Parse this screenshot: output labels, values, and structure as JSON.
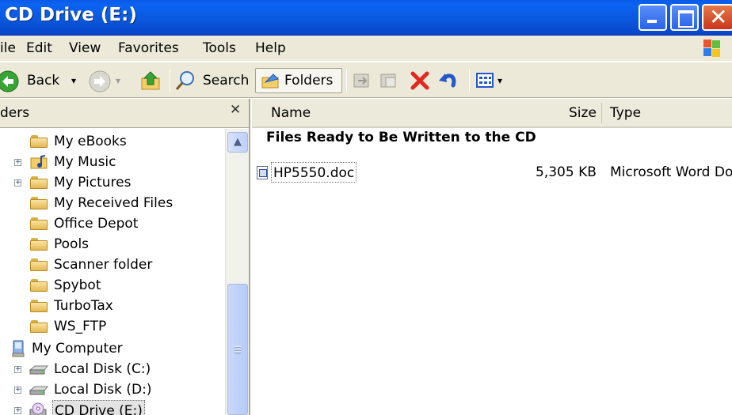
{
  "window": {
    "title": "CD Drive (E:)"
  },
  "menu": [
    "ile",
    "Edit",
    "View",
    "Favorites",
    "Tools",
    "Help"
  ],
  "toolbar": {
    "back_label": "Back",
    "search_label": "Search",
    "folders_label": "Folders"
  },
  "folders_pane": {
    "header": "ders",
    "items": [
      {
        "label": "My eBooks"
      },
      {
        "label": "My Music"
      },
      {
        "label": "My Pictures"
      },
      {
        "label": "My Received Files"
      },
      {
        "label": "Office Depot"
      },
      {
        "label": "Pools"
      },
      {
        "label": "Scanner folder"
      },
      {
        "label": "Spybot"
      },
      {
        "label": "TurboTax"
      },
      {
        "label": "WS_FTP"
      },
      {
        "label": "My Computer"
      },
      {
        "label": "Local Disk (C:)"
      },
      {
        "label": "Local Disk (D:)"
      },
      {
        "label": "CD Drive (E:)"
      }
    ]
  },
  "file_list": {
    "columns": {
      "name": "Name",
      "size": "Size",
      "type": "Type"
    },
    "group_title": "Files Ready to Be Written to the CD",
    "files": [
      {
        "name": "HP5550.doc",
        "size": "5,305 KB",
        "type": "Microsoft Word Do"
      }
    ]
  },
  "colors": {
    "titlebar": "#0a5ae6",
    "chrome": "#ece9d8",
    "close_button": "#c9361a"
  }
}
